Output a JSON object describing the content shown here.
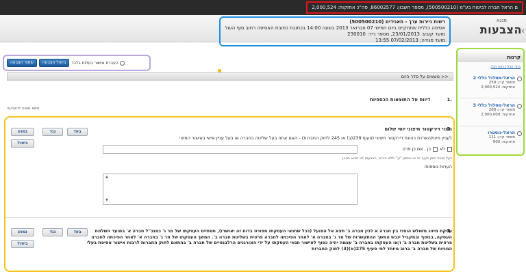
{
  "topbar": {
    "account_info": "ם הראל חברה לביטוח בע\"מ (500500210), מספר חשבון: 86002577, סה\"כ אחזקות: 2,000,524"
  },
  "header": {
    "title_small": "מנגא",
    "title": "הצבעות",
    "back_icon": "‹"
  },
  "meeting": {
    "title": "רשות ניירות ערך - תאגידים (500500210)",
    "line1": "אסיפה כללית שתתקיים ביום חמישי 07 פברואר 2013 בשעה 14:00 בכתובת כתובת האסיפה רחוב סוף העולם בע\"מ",
    "line2": "מועד קובע: 23/01/2013, מספר נייר: 230010",
    "line3": "מועד סגירה: 07/02/2013 13:55"
  },
  "vote_actions": {
    "submit_label": "שמור הצבעה",
    "cancel_label": "ביטול הצבעה",
    "owner_only_label": "העברת אישור בעלות בלבד"
  },
  "agenda": {
    "header": "<< נושאים על סדר היום"
  },
  "item1": {
    "num": ".1",
    "title": "דיווח על התוצאות הכספיות",
    "note": "נושא שאינו להצבעה"
  },
  "vote_buttons": {
    "for": "בעד",
    "against": "נגד",
    "abstain": "נמנע",
    "cancel": "ביטול"
  },
  "item2": {
    "num": ".2",
    "title": "מינוי דירקטור חיצוני יוסי שלום",
    "question": "לעניין מינוי/הארכת כהונת דירקטור חיצוני (סעיף 239(ב) או 245 לחוק החברות) - האם אתה בעל שליטה בחברה או בעל עניין אישי באישור המינוי",
    "no_label": "לא",
    "yes_label": "כן , אם כן פרט",
    "note": "בעל מניות יסמן סעיף זה או שיסמן \"כן\" וללא פירוט, הצבעתו לא תבוא במנין",
    "comments_label": "הערות נוספות:"
  },
  "item3": {
    "num": ".3",
    "text": "עסקת מיזוג משולש הופכי בין חברה א לבין חברה ב' תצא אל הפועל (ככל שתנאי העסקתו מפורט בדוח זה יאושרו), תסתיים העסקתו של מר ג' כמנכ\"ל חברה א' במועד השלמת העסקה, בנוסף ובמקביל יגבש המשך ההתקשרות של מר ג' בחברה א' לאחר הפיכתה לחברה פרטית בשליטת חברה ב'. המשך העסקתו של מר ג' בחברה א' לאחר הפיכתה לחברה פרטית בשליטת חברה ב' ו/או העסקתו בחברה ב' עצמה יהיה כפוף לאישור תנאי העסקתו על ידי האורגנים הרלבנטיים של חברה ב' בהתאם לחוק החברות לרבות אישור אסיפת בעלי המניות של חברה ב' ברוב מיוחד לפי סעיף 275(א)(3) לחוק החברות"
  },
  "accounts": {
    "header": "קרנות",
    "select_all": "בחר הכל",
    "clear_all": "נקה הכל",
    "items": [
      {
        "name": "הראל-מסלול כללי 2",
        "fund_no": "מספר קרן: 259",
        "holdings": "אחזקות: 2,000,524"
      },
      {
        "name": "הראל-מסלול כללי 3",
        "fund_no": "מספר קרן: 260",
        "holdings": "אחזקות: 2,000,000"
      },
      {
        "name": "הראל-נוסטרו",
        "fund_no": "מספר קרן: 111",
        "holdings": "אחזקות: 900"
      }
    ]
  },
  "colors": {
    "accent_blue": "#1c5c9c",
    "highlight_red": "#e0141a",
    "highlight_blue": "#1b8fe0",
    "highlight_purple": "#b7a4e0",
    "highlight_yellow": "#f7c21b",
    "highlight_green": "#9ed93a"
  }
}
